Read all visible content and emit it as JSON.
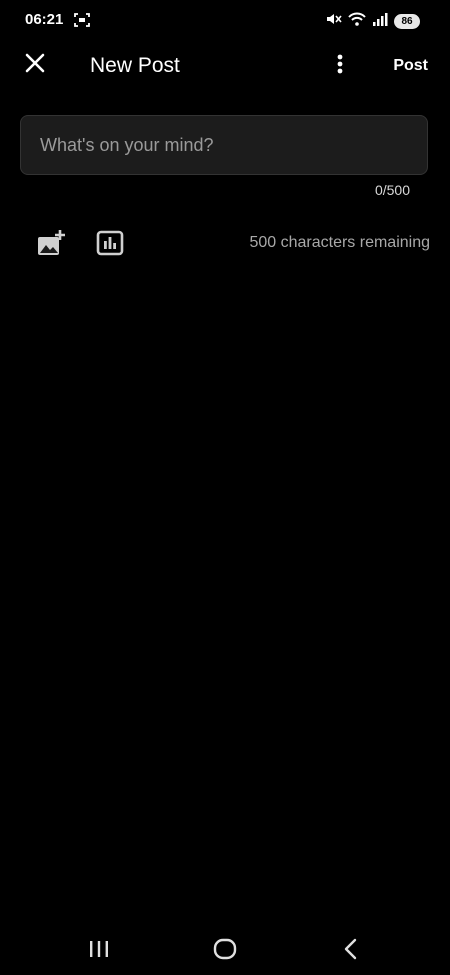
{
  "status_bar": {
    "time": "06:21",
    "battery": "86",
    "icons": [
      "screen-record-icon",
      "mute-icon",
      "wifi-icon",
      "signal-icon",
      "battery-icon"
    ]
  },
  "app_bar": {
    "title": "New Post",
    "post_label": "Post",
    "icons": [
      "close-icon",
      "more-vert-icon"
    ]
  },
  "composer": {
    "value": "",
    "placeholder": "What's on your mind?",
    "counter": "0/500"
  },
  "toolbar": {
    "icons": [
      "add-image-icon",
      "poll-icon"
    ],
    "remaining": "500 characters remaining"
  },
  "nav_bar": {
    "icons": [
      "recents-icon",
      "home-icon",
      "back-icon"
    ]
  },
  "colors": {
    "background": "#000000",
    "input_background": "#1c1c1c",
    "text": "#ffffff",
    "muted_text": "#a8a8a8"
  }
}
